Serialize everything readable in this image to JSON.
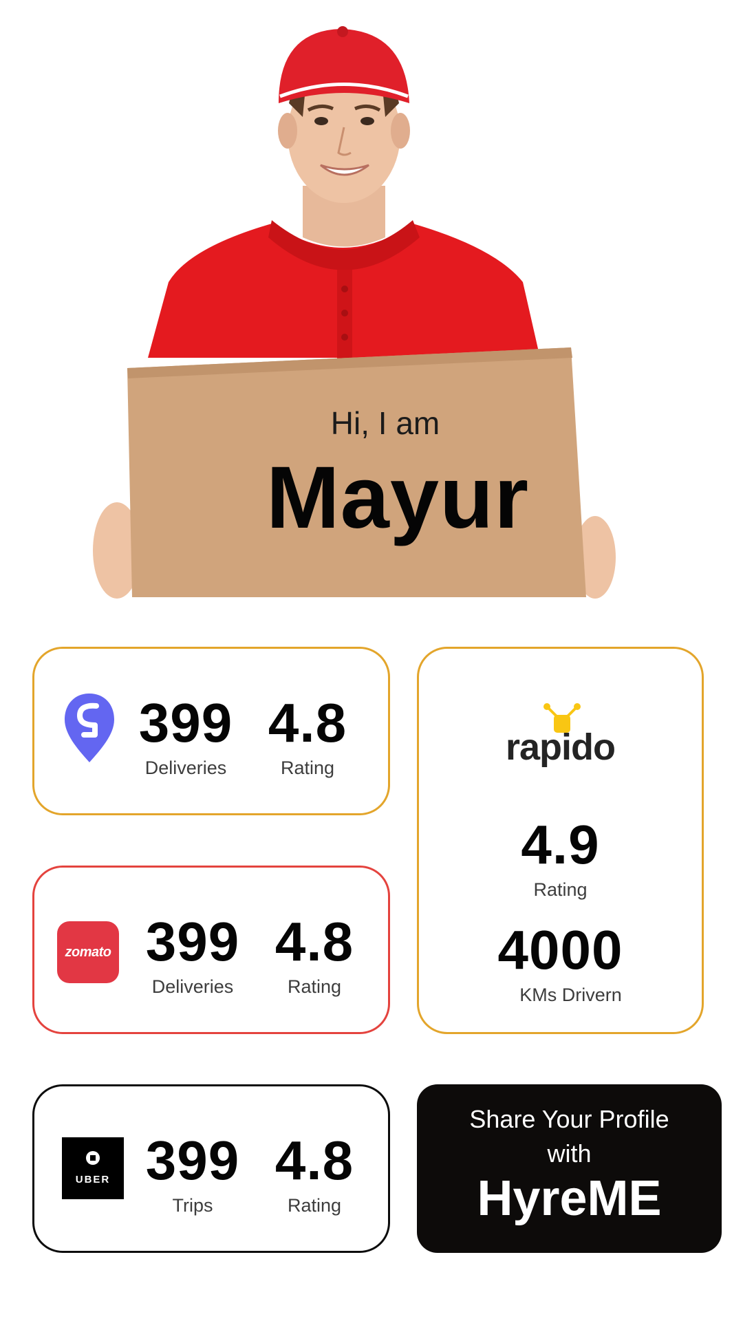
{
  "hero": {
    "greeting": "Hi, I am",
    "name": "Mayur"
  },
  "cards": {
    "swiggy": {
      "logo": "swiggy-logo",
      "brand_color": "#6366f1",
      "border_color": "#e3a52b",
      "stats": [
        {
          "value": "399",
          "label": "Deliveries"
        },
        {
          "value": "4.8",
          "label": "Rating"
        }
      ]
    },
    "zomato": {
      "logo_text": "zomato",
      "brand_color": "#e23744",
      "border_color": "#e4433e",
      "stats": [
        {
          "value": "399",
          "label": "Deliveries"
        },
        {
          "value": "4.8",
          "label": "Rating"
        }
      ]
    },
    "uber": {
      "logo_text": "UBER",
      "brand_color": "#000000",
      "border_color": "#0c0c0c",
      "stats": [
        {
          "value": "399",
          "label": "Trips"
        },
        {
          "value": "4.8",
          "label": "Rating"
        }
      ]
    },
    "rapido": {
      "logo_text": "rapido",
      "brand_color": "#f9c613",
      "border_color": "#e3a52b",
      "stats": [
        {
          "value": "4.9",
          "label": "Rating"
        },
        {
          "value": "4000",
          "label": "KMs Drivern"
        }
      ]
    },
    "share": {
      "line1": "Share Your Profile",
      "line2": "with",
      "brand": "HyreME",
      "background": "#0d0b0a"
    }
  }
}
